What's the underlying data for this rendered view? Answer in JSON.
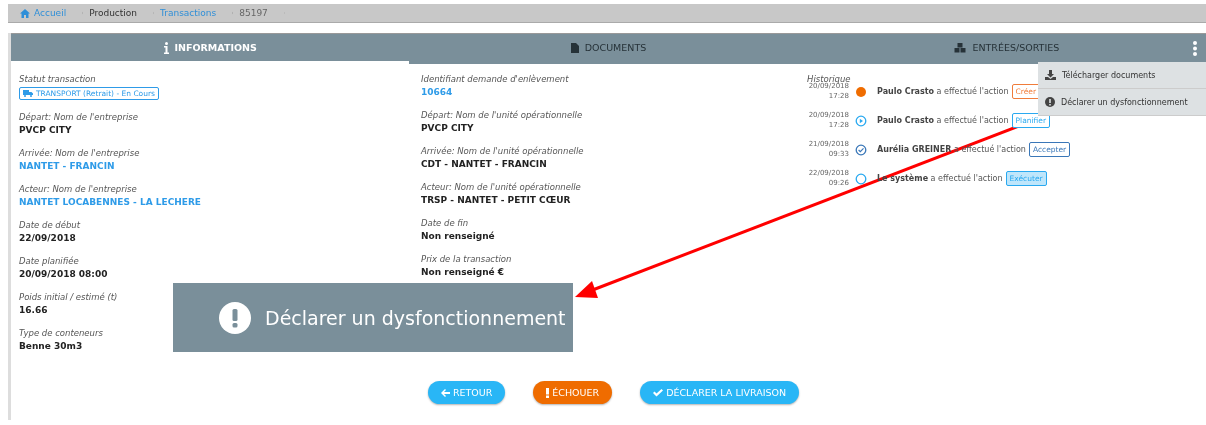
{
  "breadcrumb": [
    {
      "label": "Accueil",
      "kind": "home"
    },
    {
      "label": "Production",
      "kind": "text"
    },
    {
      "label": "Transactions",
      "kind": "link"
    },
    {
      "label": "85197",
      "kind": "muted"
    }
  ],
  "tabs": [
    {
      "label": "INFORMATIONS",
      "selected": true
    },
    {
      "label": "DOCUMENTS",
      "selected": false
    },
    {
      "label": "ENTRÉES/SORTIES",
      "selected": false
    }
  ],
  "menu": [
    {
      "label": "Télécharger documents"
    },
    {
      "label": "Déclarer un dysfonctionnement"
    }
  ],
  "columns": [
    [
      {
        "label": "Statut transaction",
        "value": "TRANSPORT (Retrait) - En Cours",
        "kind": "status"
      },
      {
        "label": "Départ: Nom de l'entreprise",
        "value": "PVCP CITY",
        "kind": "text"
      },
      {
        "label": "Arrivée: Nom de l'entreprise",
        "value": "NANTET - FRANCIN",
        "kind": "link"
      },
      {
        "label": "Acteur: Nom de l'entreprise",
        "value": "NANTET LOCABENNES - LA LECHERE",
        "kind": "link"
      },
      {
        "label": "Date de début",
        "value": "22/09/2018",
        "kind": "text"
      },
      {
        "label": "Date planifiée",
        "value": "20/09/2018 08:00",
        "kind": "text"
      },
      {
        "label": "Poids initial / estimé (t)",
        "value": "16.66",
        "kind": "text"
      },
      {
        "label": "Type de conteneurs",
        "value": "Benne 30m3",
        "kind": "text"
      }
    ],
    [
      {
        "label": "Identifiant demande d'enlèvement",
        "value": "10664",
        "kind": "link"
      },
      {
        "label": "Départ: Nom de l'unité opérationnelle",
        "value": "PVCP CITY",
        "kind": "text"
      },
      {
        "label": "Arrivée: Nom de l'unité opérationnelle",
        "value": "CDT - NANTET - FRANCIN",
        "kind": "text"
      },
      {
        "label": "Acteur: Nom de l'unité opérationnelle",
        "value": "TRSP - NANTET - PETIT CŒUR",
        "kind": "text"
      },
      {
        "label": "Date de fin",
        "value": "Non renseigné",
        "kind": "text"
      },
      {
        "label": "Prix de la transaction",
        "value": "Non renseigné €",
        "kind": "text"
      }
    ]
  ],
  "history": {
    "title": "Historique",
    "items": [
      {
        "date": "20/09/2018",
        "time": "17:28",
        "kind": "filled",
        "actor": "Paulo Crasto",
        "text": "a effectué l'action",
        "action": "Créer",
        "color": "#f07c3a",
        "filled": false
      },
      {
        "date": "20/09/2018",
        "time": "17:28",
        "kind": "play",
        "actor": "Paulo Crasto",
        "text": "a effectué l'action",
        "action": "Planifier",
        "color": "#29a9f0",
        "filled": false
      },
      {
        "date": "21/09/2018",
        "time": "09:33",
        "kind": "check",
        "actor": "Aurélia GREINER",
        "text": "a effectué l'action",
        "action": "Accepter",
        "color": "#3a77b8",
        "filled": false
      },
      {
        "date": "22/09/2018",
        "time": "09:26",
        "kind": "empty",
        "actor": "Le système",
        "text": "a effectué l'action",
        "action": "Exécuter",
        "color": "#29a9f0",
        "filled": true
      }
    ]
  },
  "callout": {
    "label": "Déclarer un dysfonctionnement"
  },
  "buttons": [
    {
      "label": "RETOUR",
      "color": "#29b6f6"
    },
    {
      "label": "ÉCHOUER",
      "color": "#ef6c00"
    },
    {
      "label": "DÉCLARER LA LIVRAISON",
      "color": "#29b6f6"
    }
  ]
}
